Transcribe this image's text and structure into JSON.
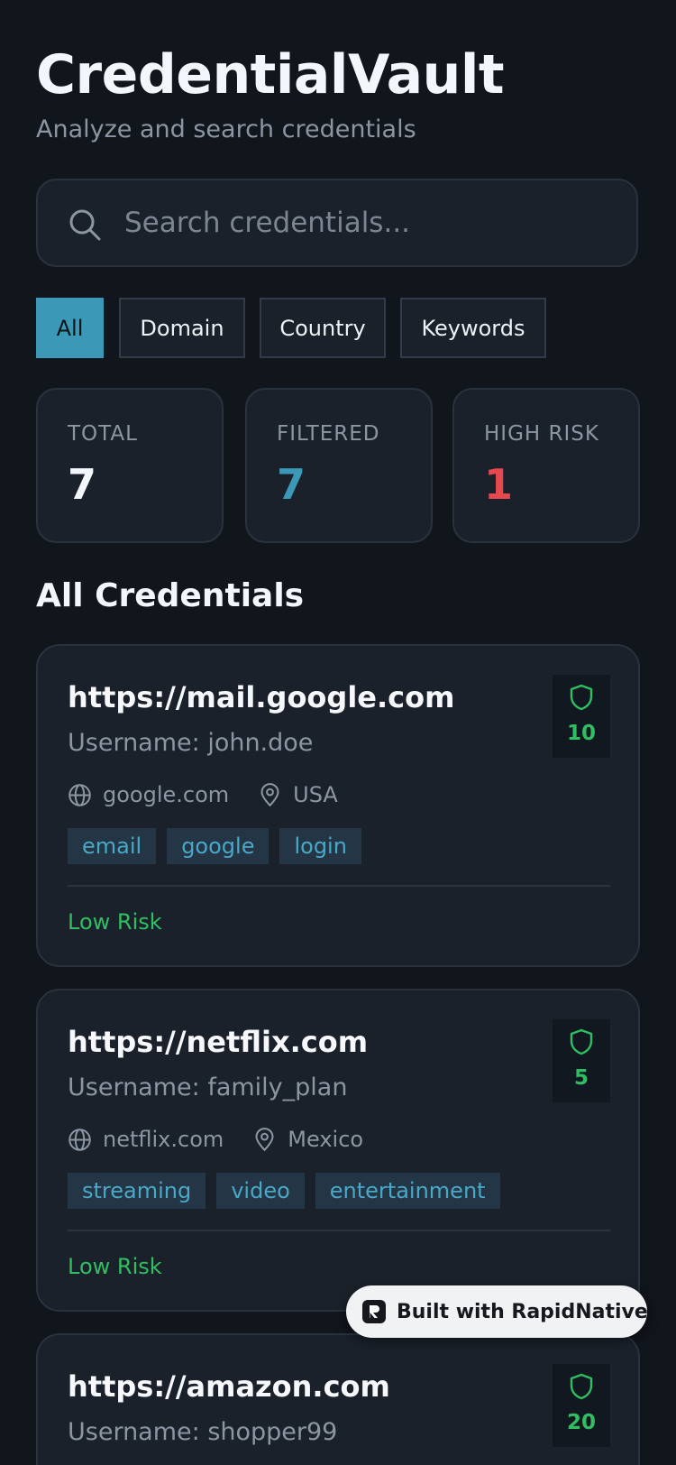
{
  "header": {
    "title": "CredentialVault",
    "subtitle": "Analyze and search credentials"
  },
  "search": {
    "placeholder": "Search credentials...",
    "value": ""
  },
  "filters": {
    "tabs": [
      {
        "label": "All",
        "active": true
      },
      {
        "label": "Domain",
        "active": false
      },
      {
        "label": "Country",
        "active": false
      },
      {
        "label": "Keywords",
        "active": false
      }
    ]
  },
  "stats": {
    "total": {
      "label": "TOTAL",
      "value": "7"
    },
    "filtered": {
      "label": "FILTERED",
      "value": "7"
    },
    "high_risk": {
      "label": "HIGH RISK",
      "value": "1"
    }
  },
  "section": {
    "title": "All Credentials"
  },
  "credentials": [
    {
      "url": "https://mail.google.com",
      "username": "Username: john.doe",
      "domain": "google.com",
      "country": "USA",
      "tags": [
        "email",
        "google",
        "login"
      ],
      "risk": "Low Risk",
      "score": "10"
    },
    {
      "url": "https://netflix.com",
      "username": "Username: family_plan",
      "domain": "netflix.com",
      "country": "Mexico",
      "tags": [
        "streaming",
        "video",
        "entertainment"
      ],
      "risk": "Low Risk",
      "score": "5"
    },
    {
      "url": "https://amazon.com",
      "username": "Username: shopper99",
      "score": "20"
    }
  ],
  "badge": {
    "label": "Built with RapidNative"
  },
  "colors": {
    "background": "#11151c",
    "card": "#1b212b",
    "accent": "#3b98b6",
    "danger": "#e5484d",
    "success": "#2fbf62",
    "muted_text": "#8c96a3"
  },
  "icons": [
    "search-icon",
    "globe-icon",
    "location-pin-icon",
    "shield-icon",
    "rapidnative-logo-icon"
  ]
}
